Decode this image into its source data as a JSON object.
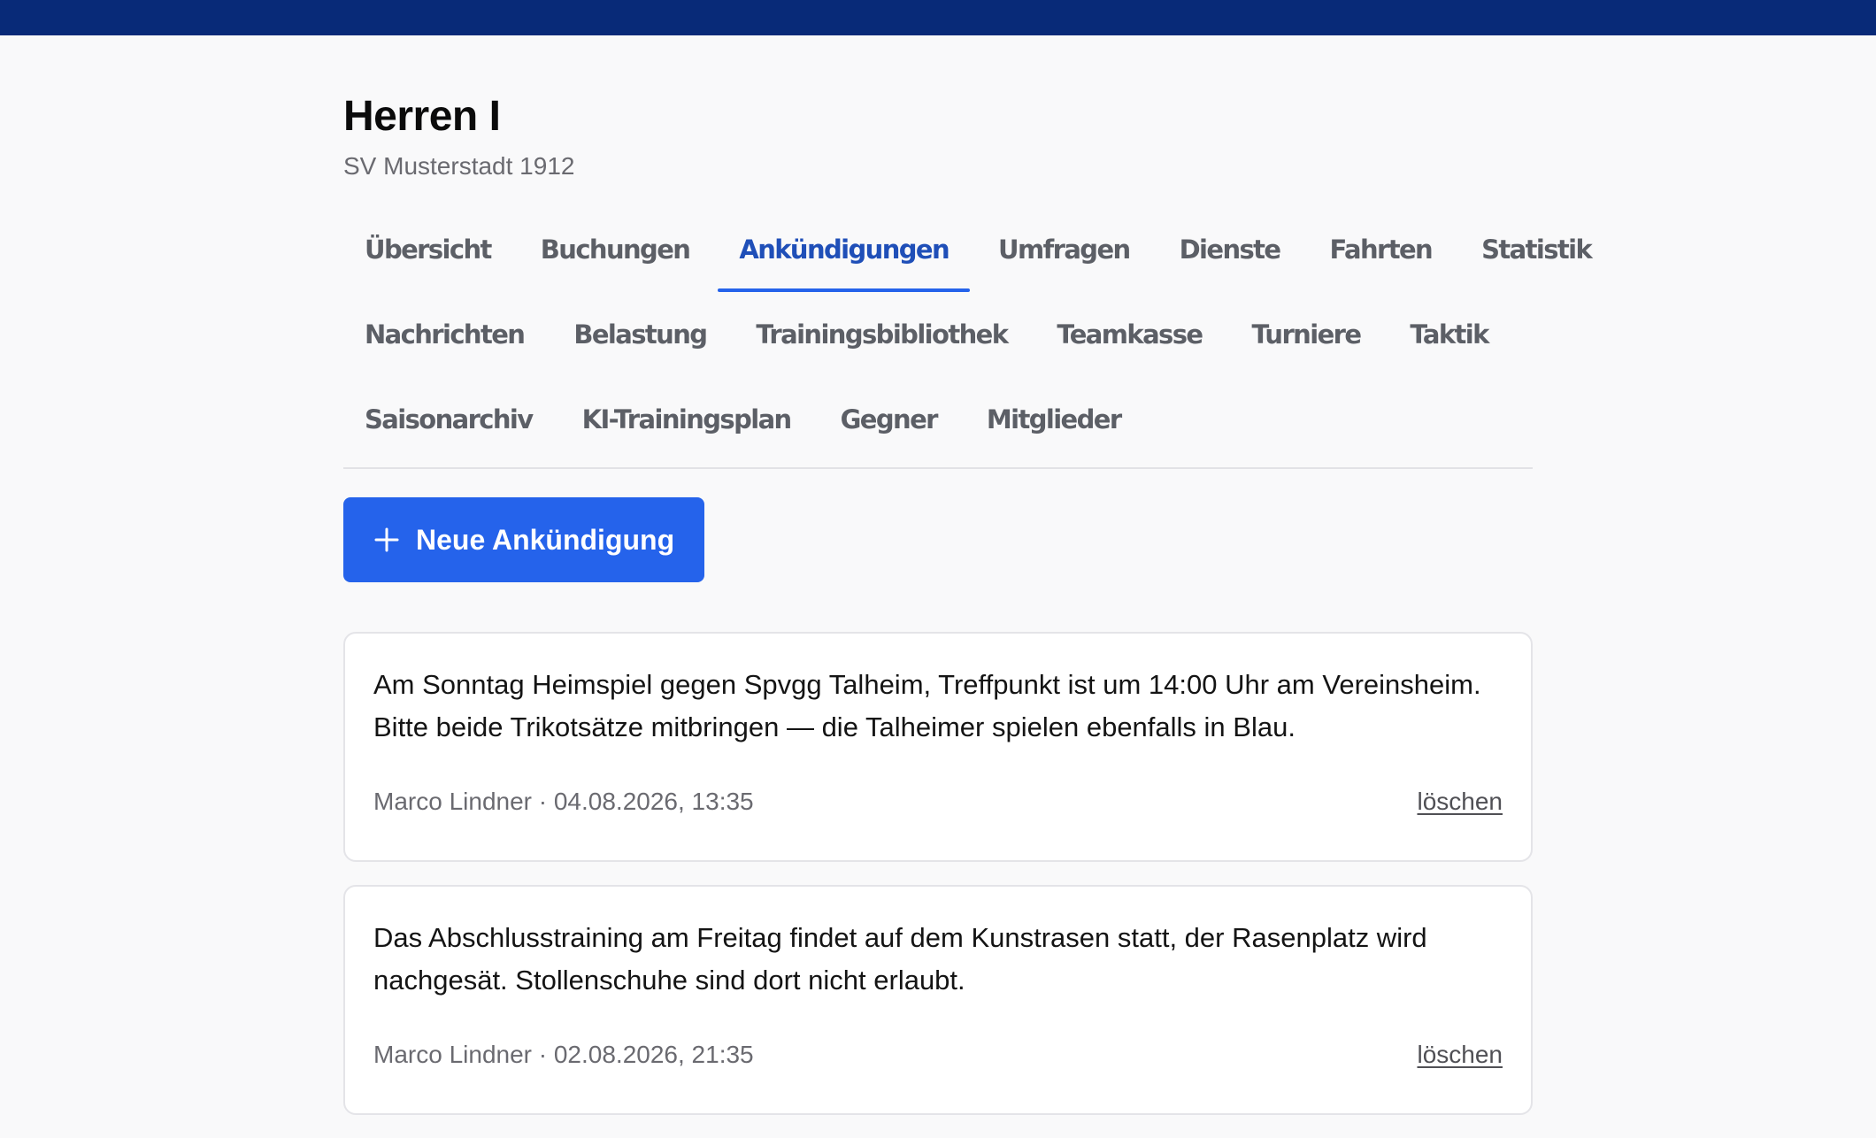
{
  "team": {
    "name": "Herren I",
    "club": "SV Musterstadt 1912"
  },
  "tabs": {
    "rows": [
      [
        {
          "label": "Übersicht",
          "active": false
        },
        {
          "label": "Buchungen",
          "active": false
        },
        {
          "label": "Ankündigungen",
          "active": true
        },
        {
          "label": "Umfragen",
          "active": false
        },
        {
          "label": "Dienste",
          "active": false
        },
        {
          "label": "Fahrten",
          "active": false
        },
        {
          "label": "Statistik",
          "active": false
        }
      ],
      [
        {
          "label": "Nachrichten",
          "active": false
        },
        {
          "label": "Belastung",
          "active": false
        },
        {
          "label": "Trainingsbibliothek",
          "active": false
        },
        {
          "label": "Teamkasse",
          "active": false
        },
        {
          "label": "Turniere",
          "active": false
        },
        {
          "label": "Taktik",
          "active": false
        }
      ],
      [
        {
          "label": "Saisonarchiv",
          "active": false
        },
        {
          "label": "KI-Trainingsplan",
          "active": false
        },
        {
          "label": "Gegner",
          "active": false
        },
        {
          "label": "Mitglieder",
          "active": false
        }
      ]
    ]
  },
  "actions": {
    "new_announcement_label": "Neue Ankündigung",
    "new_announcement_icon": "plus-icon"
  },
  "announcements": [
    {
      "text": "Am Sonntag Heimspiel gegen Spvgg Talheim, Treffpunkt ist um 14:00 Uhr am Vereinsheim. Bitte beide Trikotsätze mitbringen — die Talheimer spielen ebenfalls in Blau.",
      "meta": "Marco Lindner · 04.08.2026, 13:35",
      "delete_label": "löschen"
    },
    {
      "text": "Das Abschlusstraining am Freitag findet auf dem Kunstrasen statt, der Rasenplatz wird nachgesät. Stollenschuhe sind dort nicht erlaubt.",
      "meta": "Marco Lindner · 02.08.2026, 21:35",
      "delete_label": "löschen"
    }
  ],
  "colors": {
    "topbar": "#082a78",
    "accent": "#2563eb",
    "active_tab_text": "#1f4fb8",
    "background": "#f9f9fa"
  }
}
